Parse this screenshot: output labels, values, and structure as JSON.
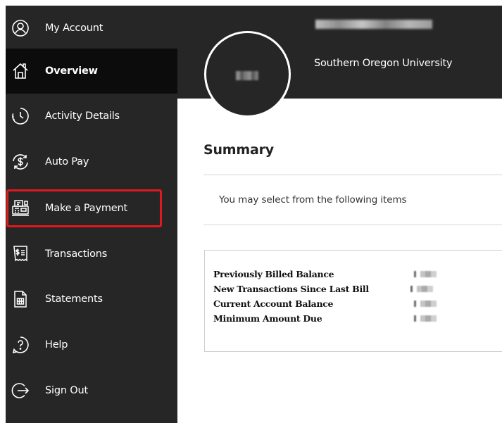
{
  "sidebar": {
    "items": [
      {
        "label": "My Account",
        "icon": "user-circle-icon"
      },
      {
        "label": "Overview",
        "icon": "home-icon"
      },
      {
        "label": "Activity Details",
        "icon": "clock-icon"
      },
      {
        "label": "Auto Pay",
        "icon": "refresh-dollar-icon"
      },
      {
        "label": "Make a Payment",
        "icon": "payment-terminal-icon"
      },
      {
        "label": "Transactions",
        "icon": "receipt-dollar-icon"
      },
      {
        "label": "Statements",
        "icon": "document-grid-icon"
      },
      {
        "label": "Help",
        "icon": "help-circle-icon"
      },
      {
        "label": "Sign Out",
        "icon": "sign-out-icon"
      }
    ]
  },
  "header": {
    "university": "Southern Oregon University"
  },
  "main": {
    "title": "Summary",
    "select_text": "You may select from the following items",
    "balances": [
      {
        "label": "Previously Billed Balance"
      },
      {
        "label": "New Transactions Since Last Bill"
      },
      {
        "label": "Current Account Balance"
      },
      {
        "label": "Minimum Amount Due"
      }
    ]
  },
  "colors": {
    "sidebar_bg": "#262626",
    "active_bg": "#0c0c0c",
    "highlight": "#e0191e"
  }
}
